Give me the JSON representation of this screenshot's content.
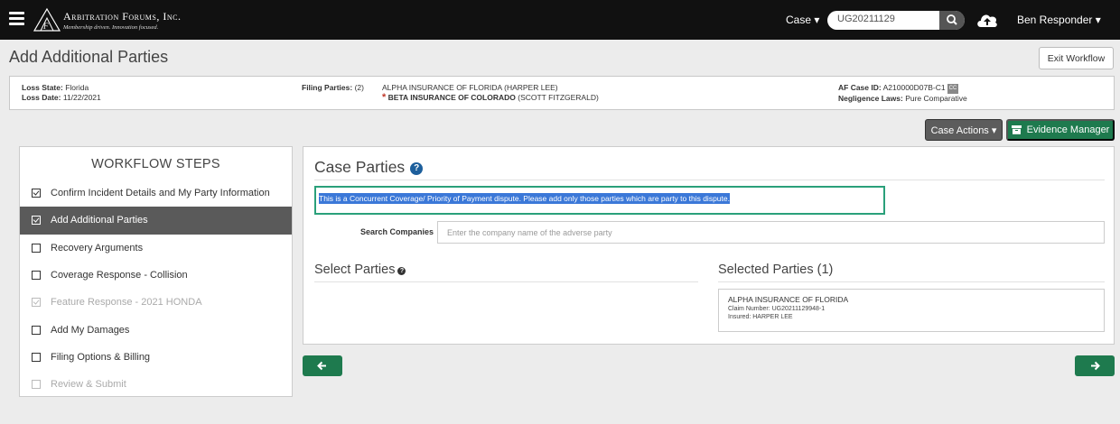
{
  "nav": {
    "logo_title": "Arbitration Forums, Inc.",
    "logo_tagline": "Membership driven. Innovation focused.",
    "case_menu": "Case ▾",
    "search_value": "UG20211129",
    "user_menu": "Ben Responder ▾"
  },
  "page": {
    "title": "Add Additional Parties",
    "exit_label": "Exit Workflow"
  },
  "info": {
    "loss_state_label": "Loss State:",
    "loss_state": "Florida",
    "loss_date_label": "Loss Date:",
    "loss_date": "11/22/2021",
    "filing_parties_label": "Filing Parties:",
    "filing_parties_count": "(2)",
    "party1": "ALPHA INSURANCE OF FLORIDA",
    "party1_contact": "(HARPER LEE)",
    "party2": "BETA INSURANCE OF COLORADO",
    "party2_contact": "(SCOTT FITZGERALD)",
    "case_id_label": "AF Case ID:",
    "case_id": "A210000D07B-C1",
    "cc_badge": "CC",
    "negligence_label": "Negligence Laws:",
    "negligence": "Pure Comparative"
  },
  "actions": {
    "case_actions": "Case Actions ▾",
    "evidence_manager": "Evidence Manager"
  },
  "workflow": {
    "title": "WORKFLOW STEPS",
    "steps": [
      {
        "label": "Confirm Incident Details and My Party Information",
        "checked": true,
        "state": "normal"
      },
      {
        "label": "Add Additional Parties",
        "checked": true,
        "state": "active"
      },
      {
        "label": "Recovery Arguments",
        "checked": false,
        "state": "normal"
      },
      {
        "label": "Coverage Response - Collision",
        "checked": false,
        "state": "normal"
      },
      {
        "label": "Feature Response - 2021 HONDA",
        "checked": true,
        "state": "disabled"
      },
      {
        "label": "Add My Damages",
        "checked": false,
        "state": "normal"
      },
      {
        "label": "Filing Options & Billing",
        "checked": false,
        "state": "normal"
      },
      {
        "label": "Review & Submit",
        "checked": false,
        "state": "disabled"
      }
    ]
  },
  "main": {
    "title": "Case Parties",
    "notice": "This is a Concurrent Coverage/ Priority of Payment dispute. Please add only those parties which are party to this dispute.",
    "search_label": "Search Companies",
    "search_placeholder": "Enter the company name of the adverse party",
    "select_title": "Select Parties",
    "selected_title": "Selected Parties (1)",
    "selected": [
      {
        "name": "ALPHA INSURANCE OF FLORIDA",
        "claim": "Claim Number: UG20211129948-1",
        "insured": "Insured: HARPER LEE"
      }
    ]
  },
  "colors": {
    "accent_green": "#1e7a4e",
    "notice_border": "#2aa07a",
    "highlight": "#3b78d8",
    "help_blue": "#1d5f9c",
    "star_red": "#c0392b"
  },
  "icons": [
    "menu-icon",
    "search-icon",
    "cloud-upload-icon",
    "archive-icon",
    "help-icon",
    "arrow-left-icon",
    "arrow-right-icon"
  ]
}
